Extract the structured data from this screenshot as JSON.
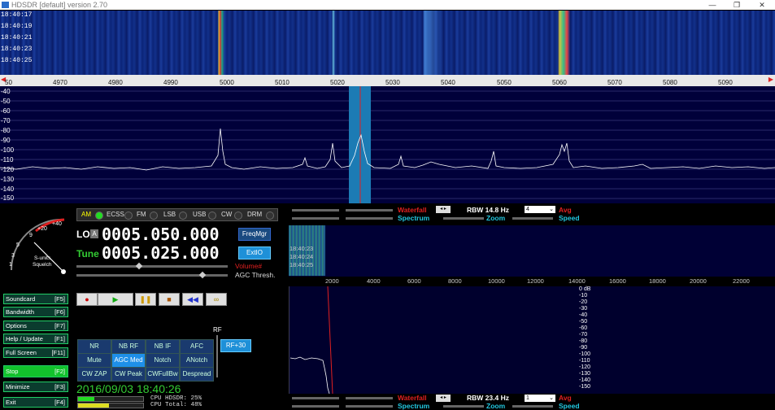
{
  "window": {
    "title": "HDSDR [default]  version 2.70"
  },
  "waterfall_top": {
    "times": [
      "18:40:17",
      "18:40:19",
      "18:40:21",
      "18:40:23",
      "18:40:25"
    ]
  },
  "scale": {
    "ticks": [
      "50",
      "4970",
      "4980",
      "4990",
      "5000",
      "5010",
      "5020",
      "5030",
      "5040",
      "5050",
      "5060",
      "5070",
      "5080",
      "5090"
    ]
  },
  "spectrum": {
    "db_labels": [
      "-40",
      "-50",
      "-60",
      "-70",
      "-80",
      "-90",
      "-100",
      "-110",
      "-120",
      "-130",
      "-140",
      "-150"
    ]
  },
  "modes": {
    "items": [
      "AM",
      "ECSS",
      "FM",
      "LSB",
      "USB",
      "CW",
      "DRM"
    ],
    "active": "AM"
  },
  "smeter": {
    "scale_labels": [
      "+40",
      "+20",
      "9",
      "5",
      "3",
      "1"
    ],
    "label1": "S-units",
    "label2": "Squelch"
  },
  "lo": {
    "label": "LO",
    "tag": "A",
    "value": "0005.050.000"
  },
  "tune": {
    "label": "Tune",
    "value": "0005.025.000"
  },
  "buttons": {
    "freqmgr": "FreqMgr",
    "extio": "ExtIO"
  },
  "volume": {
    "label": "Volume#",
    "agc": "AGC Thresh."
  },
  "side": [
    {
      "label": "Soundcard",
      "key": "[F5]"
    },
    {
      "label": "Bandwidth",
      "key": "[F6]"
    },
    {
      "label": "Options",
      "key": "[F7]"
    },
    {
      "label": "Help / Update",
      "key": "[F1]"
    },
    {
      "label": "Full Screen",
      "key": "[F11]"
    },
    {
      "label": "Stop",
      "key": "[F2]"
    },
    {
      "label": "Minimize",
      "key": "[F3]"
    },
    {
      "label": "Exit",
      "key": "[F4]"
    }
  ],
  "dsp": {
    "row1": [
      "NR",
      "NB RF",
      "NB IF",
      "AFC"
    ],
    "row2": [
      "Mute",
      "AGC Med",
      "Notch",
      "ANotch"
    ],
    "row3": [
      "CW ZAP",
      "CW Peak",
      "CWFullBw",
      "Despread"
    ],
    "rf_label": "RF",
    "rf_value": "RF+30"
  },
  "datetime": "2016/09/03 18:40:26",
  "cpu": {
    "hdsdr": "CPU HDSDR: 25%",
    "total": "CPU Total:  48%"
  },
  "upper_ctrl": {
    "waterfall": "Waterfall",
    "spectrum": "Spectrum",
    "rbw": "RBW 14.8 Hz",
    "avg_val": "4",
    "avg": "Avg",
    "zoom": "Zoom",
    "speed": "Speed"
  },
  "lower_ctrl": {
    "waterfall": "Waterfall",
    "spectrum": "Spectrum",
    "rbw": "RBW 23.4 Hz",
    "avg_val": "1",
    "avg": "Avg",
    "zoom": "Zoom",
    "speed": "Speed"
  },
  "af_waterfall": {
    "times": [
      "18:40:23",
      "18:40:24",
      "18:40:25"
    ],
    "x_ticks": [
      "2000",
      "4000",
      "6000",
      "8000",
      "10000",
      "12000",
      "14000",
      "16000",
      "18000",
      "20000",
      "22000"
    ]
  },
  "af_spectrum": {
    "db_labels": [
      "0 dB",
      "-10",
      "-20",
      "-30",
      "-40",
      "-50",
      "-60",
      "-70",
      "-80",
      "-90",
      "-100",
      "-110",
      "-120",
      "-130",
      "-140",
      "-150"
    ]
  },
  "colors": {
    "accent": "#1e90d8",
    "waterfall_red": "#e02020",
    "spectrum_cyan": "#22c8e0",
    "stop_green": "#12c22c"
  }
}
